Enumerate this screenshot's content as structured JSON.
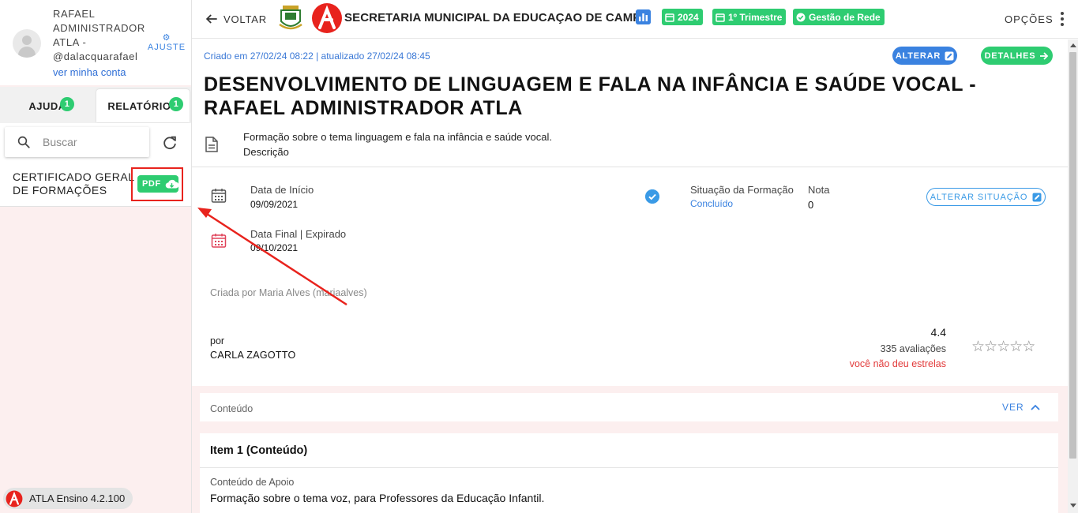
{
  "sidebar": {
    "user_name": "RAFAEL ADMINISTRADOR ATLA - @dalacquarafael",
    "user_link": "ver minha conta",
    "settings_label": "AJUSTE",
    "tabs": [
      {
        "label": "AJUDA",
        "count": "1"
      },
      {
        "label": "RELATÓRIOS",
        "count": "1"
      }
    ],
    "search_placeholder": "Buscar",
    "certificate_label": "CERTIFICADO GERAL DE FORMAÇÕES",
    "pdf_label": "PDF",
    "version": "ATLA Ensino 4.2.100"
  },
  "header": {
    "back_label": "VOLTAR",
    "title": "SECRETARIA MUNICIPAL DA EDUCAÇAO DE CAMPO",
    "badges": [
      "2024",
      "1º Trimestre",
      "Gestão de Rede"
    ],
    "options_label": "OPÇÕES"
  },
  "main": {
    "created": "Criado em 27/02/24 08:22 | atualizado 27/02/24 08:45",
    "alterar_label": "ALTERAR",
    "detalhes_label": "DETALHES",
    "title": "DESENVOLVIMENTO DE LINGUAGEM E FALA NA INFÂNCIA E SAÚDE VOCAL - RAFAEL ADMINISTRADOR ATLA",
    "description": "Formação sobre o tema linguagem e fala na infância e saúde vocal.",
    "description_label": "Descrição",
    "start_label": "Data de Início",
    "start_value": "09/09/2021",
    "end_label": "Data Final | Expirado",
    "end_value": "09/10/2021",
    "situacao_label": "Situação da Formação",
    "situacao_value": "Concluído",
    "nota_label": "Nota",
    "nota_value": "0",
    "alterar_situacao_label": "ALTERAR SITUAÇÃO",
    "created_by": "Criada por Maria Alves (mariaalves)",
    "by_label": "por",
    "author": "CARLA ZAGOTTO",
    "rating": "4.4",
    "rating_count": "335 avaliações",
    "rating_you": "você não deu estrelas",
    "conteudo_label": "Conteúdo",
    "ver_label": "VER",
    "item_title": "Item 1 (Conteúdo)",
    "apoio_label": "Conteúdo de Apoio",
    "apoio_text": "Formação sobre o tema voz, para Professores da Educação Infantil."
  },
  "colors": {
    "accent_blue": "#3a82e0",
    "green": "#2ecc71",
    "annotation_red": "#e8231d",
    "sidebar_bg": "#fcefef"
  },
  "icons": [
    "search-icon",
    "refresh-icon",
    "cloud-download-icon",
    "arrow-left-icon",
    "chart-icon",
    "calendar-icon",
    "edit-icon",
    "arrow-right-icon",
    "document-icon",
    "check-circle-icon",
    "chevron-up-icon",
    "star-icon",
    "more-vert-icon"
  ]
}
